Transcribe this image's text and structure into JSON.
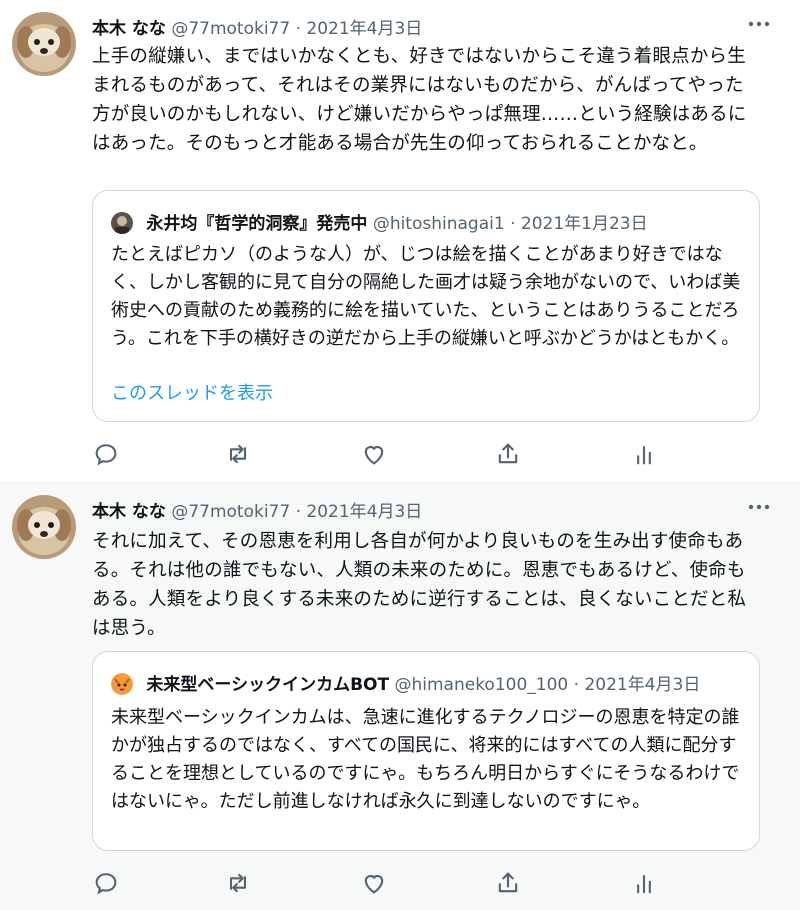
{
  "tweets": [
    {
      "name": "本木 なな",
      "handle": "@77motoki77",
      "separator": "·",
      "date": "2021年4月3日",
      "text": "上手の縦嫌い、まではいかなくとも、好きではないからこそ違う着眼点から生まれるものがあって、それはその業界にはないものだから、がんばってやった方が良いのかもしれない、けど嫌いだからやっぱ無理……という経験はあるにはあった。そのもっと才能ある場合が先生の仰っておられることかなと。",
      "quote": {
        "name": "永井均『哲学的洞察』発売中",
        "handle": "@hitoshinagai1",
        "separator": "·",
        "date": "2021年1月23日",
        "text": "たとえばピカソ（のような人）が、じつは絵を描くことがあまり好きではなく、しかし客観的に見て自分の隔絶した画才は疑う余地がないので、いわば美術史への貢献のため義務的に絵を描いていた、ということはありうることだろう。これを下手の横好きの逆だから上手の縦嫌いと呼ぶかどうかはともかく。",
        "link": "このスレッドを表示"
      }
    },
    {
      "name": "本木 なな",
      "handle": "@77motoki77",
      "separator": "·",
      "date": "2021年4月3日",
      "text": "それに加えて、その恩恵を利用し各自が何かより良いものを生み出す使命もある。それは他の誰でもない、人類の未来のために。恩恵でもあるけど、使命もある。人類をより良くする未来のために逆行することは、良くないことだと私は思う。",
      "quote": {
        "name": "未来型ベーシックインカムBOT",
        "handle": "@himaneko100_100",
        "separator": "·",
        "date": "2021年4月3日",
        "text": "未来型ベーシックインカムは、急速に進化するテクノロジーの恩恵を特定の誰かが独占するのではなく、すべての国民に、将来的にはすべての人類に配分することを理想としているのですにゃ。もちろん明日からすぐにそうなるわけではないにゃ。ただし前進しなければ永久に到達しないのですにゃ。"
      }
    }
  ],
  "icons": [
    "more-icon",
    "reply-icon",
    "retweet-icon",
    "like-icon",
    "share-icon",
    "analytics-icon"
  ],
  "colors": {
    "link": "#1d9bf0",
    "secondary": "#536471",
    "border": "#cfd9de"
  }
}
